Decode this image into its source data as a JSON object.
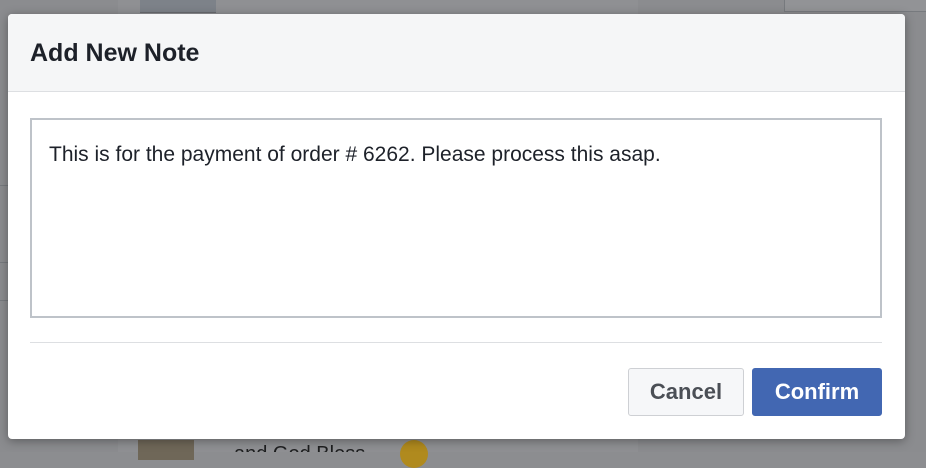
{
  "background": {
    "partial_name_text": "",
    "partial_post_text": "and God Bless"
  },
  "modal": {
    "title": "Add New Note",
    "note_text": "This is for the payment of order # 6262. Please process this asap.",
    "cancel_label": "Cancel",
    "confirm_label": "Confirm"
  },
  "colors": {
    "primary_button": "#4267b2",
    "header_background": "#f5f6f7",
    "border": "#bec3c9"
  }
}
